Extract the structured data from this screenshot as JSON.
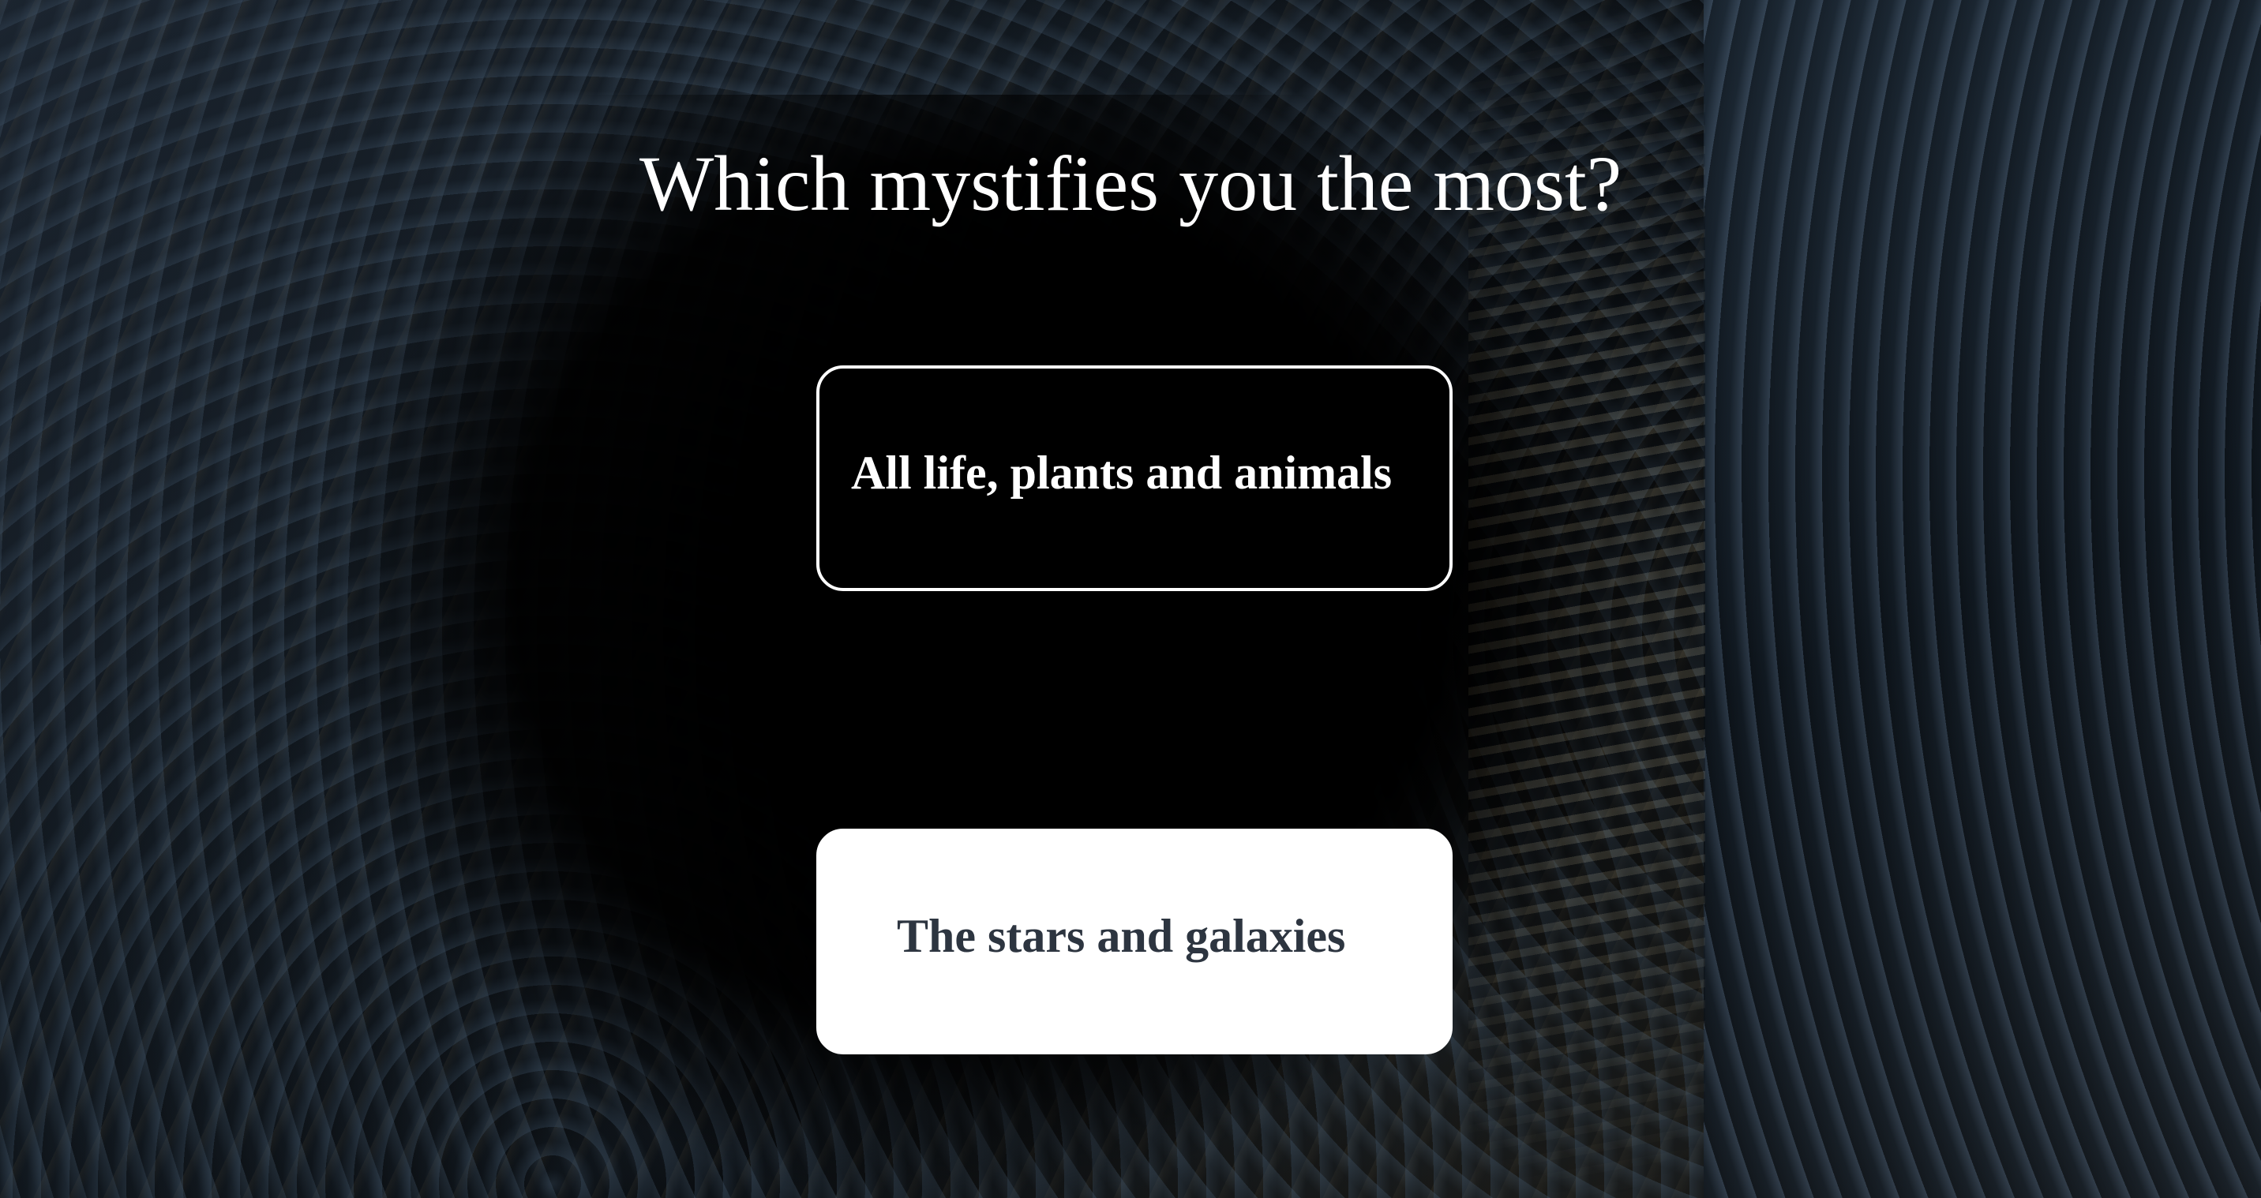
{
  "quiz": {
    "question": "Which mystifies you the most?",
    "options": [
      {
        "label": "All life, plants and animals",
        "selected": false
      },
      {
        "label": "The stars and galaxies",
        "selected": true
      }
    ]
  },
  "colors": {
    "text": "#ffffff",
    "option_default_bg": "#000000",
    "option_selected_bg": "#ffffff",
    "option_selected_text": "#2d3540"
  }
}
